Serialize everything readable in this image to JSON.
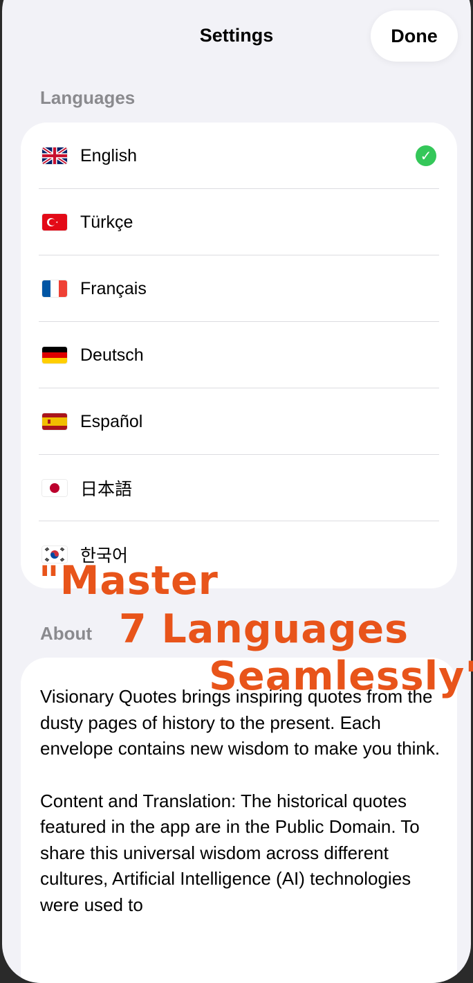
{
  "header": {
    "title": "Settings",
    "done_label": "Done"
  },
  "languages": {
    "section_title": "Languages",
    "items": [
      {
        "label": "English",
        "flag": "uk-flag-icon",
        "selected": true
      },
      {
        "label": "Türkçe",
        "flag": "turkey-flag-icon",
        "selected": false
      },
      {
        "label": "Français",
        "flag": "france-flag-icon",
        "selected": false
      },
      {
        "label": "Deutsch",
        "flag": "germany-flag-icon",
        "selected": false
      },
      {
        "label": "Español",
        "flag": "spain-flag-icon",
        "selected": false
      },
      {
        "label": "日本語",
        "flag": "japan-flag-icon",
        "selected": false
      },
      {
        "label": "한국어",
        "flag": "korea-flag-icon",
        "selected": false
      }
    ]
  },
  "about": {
    "section_title": "About",
    "paragraph_1": "Visionary Quotes brings inspiring quotes from the dusty pages of history to the present. Each envelope contains new wisdom to make you think.",
    "paragraph_2": "Content and Translation: The historical quotes featured in the app are in the Public Domain. To share this universal wisdom across different cultures, Artificial Intelligence (AI) technologies were used to"
  },
  "promo": {
    "line_1": "\"Master",
    "line_2": "7 Languages",
    "line_3": "Seamlessly\""
  },
  "colors": {
    "accent": "#e8541a",
    "check": "#34c759",
    "background": "#f2f2f7"
  }
}
